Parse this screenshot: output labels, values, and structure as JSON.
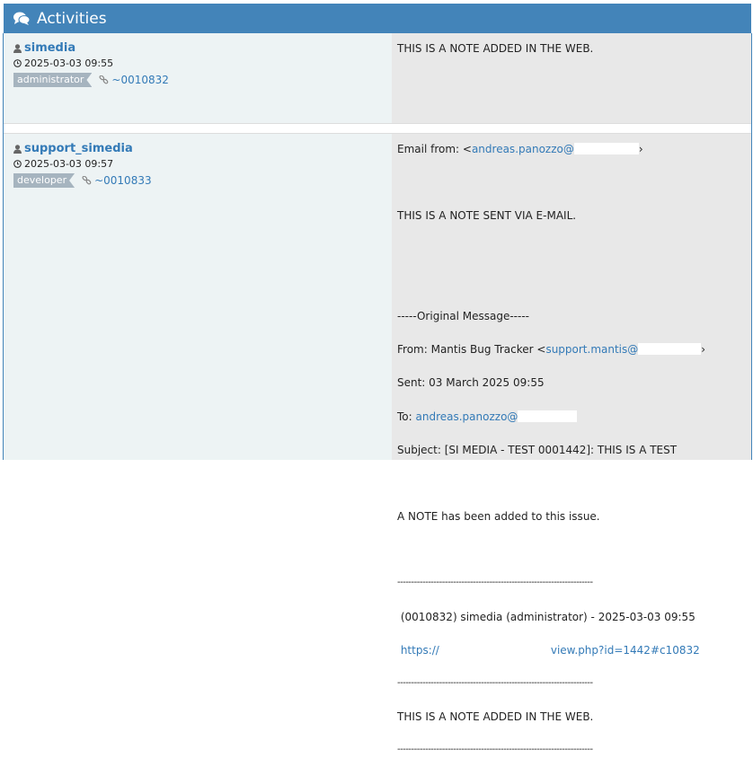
{
  "header": {
    "title": "Activities",
    "icon": "comments-icon"
  },
  "notes": [
    {
      "user": "simedia",
      "timestamp": "2025-03-03 09:55",
      "role": "administrator",
      "note_id": "~0010832",
      "text": "THIS IS A NOTE ADDED IN THE WEB."
    },
    {
      "user": "support_simedia",
      "timestamp": "2025-03-03 09:57",
      "role": "developer",
      "note_id": "~0010833",
      "email": {
        "from_label": "Email from: <",
        "from_addr": "andreas.panozzo@",
        "body1": "THIS IS A NOTE SENT VIA E-MAIL.",
        "orig_header": "-----Original Message-----",
        "from_line_label": "From: Mantis Bug Tracker <",
        "from_line_addr": "support.mantis@",
        "sent_line": "Sent: 03 March 2025 09:55",
        "to_label": "To: ",
        "to_addr": "andreas.panozzo@",
        "subject_line": "Subject: [SI MEDIA - TEST 0001442]: THIS IS A TEST",
        "added_line": "A NOTE has been added to this issue.",
        "dashes": "----------------------------------------------------------------------",
        "note_ref": " (0010832) simedia (administrator) - 2025-03-03 09:55",
        "url_start": "https://",
        "url_end": "view.php?id=1442#c10832",
        "quoted_text": "THIS IS A NOTE ADDED IN THE WEB."
      }
    }
  ]
}
